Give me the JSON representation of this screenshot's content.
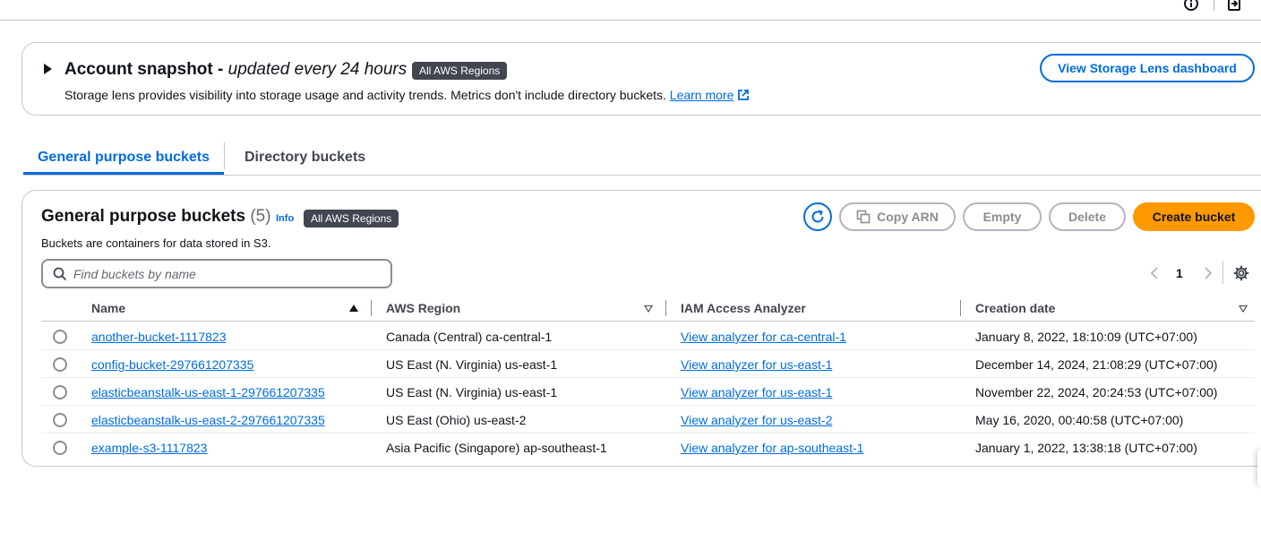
{
  "topbar": {
    "info_icon": "info-icon",
    "export_icon": "export-icon"
  },
  "snapshot": {
    "title": "Account snapshot - ",
    "title_italic": "updated every 24 hours",
    "badge": "All AWS Regions",
    "description": "Storage lens provides visibility into storage usage and activity trends. Metrics don't include directory buckets. ",
    "learn_more": "Learn more",
    "button": "View Storage Lens dashboard"
  },
  "tabs": [
    {
      "label": "General purpose buckets",
      "active": true
    },
    {
      "label": "Directory buckets",
      "active": false
    }
  ],
  "panel": {
    "title": "General purpose buckets",
    "count": "(5)",
    "info": "Info",
    "badge": "All AWS Regions",
    "description": "Buckets are containers for data stored in S3.",
    "search_placeholder": "Find buckets by name",
    "buttons": {
      "copy_arn": "Copy ARN",
      "empty": "Empty",
      "delete": "Delete",
      "create": "Create bucket"
    },
    "page": "1"
  },
  "table": {
    "columns": [
      "Name",
      "AWS Region",
      "IAM Access Analyzer",
      "Creation date"
    ],
    "rows": [
      {
        "name": "another-bucket-1117823",
        "region": "Canada (Central) ca-central-1",
        "iam": "View analyzer for ca-central-1",
        "date": "January 8, 2022, 18:10:09 (UTC+07:00)"
      },
      {
        "name": "config-bucket-297661207335",
        "region": "US East (N. Virginia) us-east-1",
        "iam": "View analyzer for us-east-1",
        "date": "December 14, 2024, 21:08:29 (UTC+07:00)"
      },
      {
        "name": "elasticbeanstalk-us-east-1-297661207335",
        "region": "US East (N. Virginia) us-east-1",
        "iam": "View analyzer for us-east-1",
        "date": "November 22, 2024, 20:24:53 (UTC+07:00)"
      },
      {
        "name": "elasticbeanstalk-us-east-2-297661207335",
        "region": "US East (Ohio) us-east-2",
        "iam": "View analyzer for us-east-2",
        "date": "May 16, 2020, 00:40:58 (UTC+07:00)"
      },
      {
        "name": "example-s3-1117823",
        "region": "Asia Pacific (Singapore) ap-southeast-1",
        "iam": "View analyzer for ap-southeast-1",
        "date": "January 1, 2022, 13:38:18 (UTC+07:00)"
      }
    ]
  },
  "colors": {
    "link": "#006ce0",
    "primary": "#ff9900",
    "badge": "#424650",
    "border": "#c6c6cd"
  }
}
